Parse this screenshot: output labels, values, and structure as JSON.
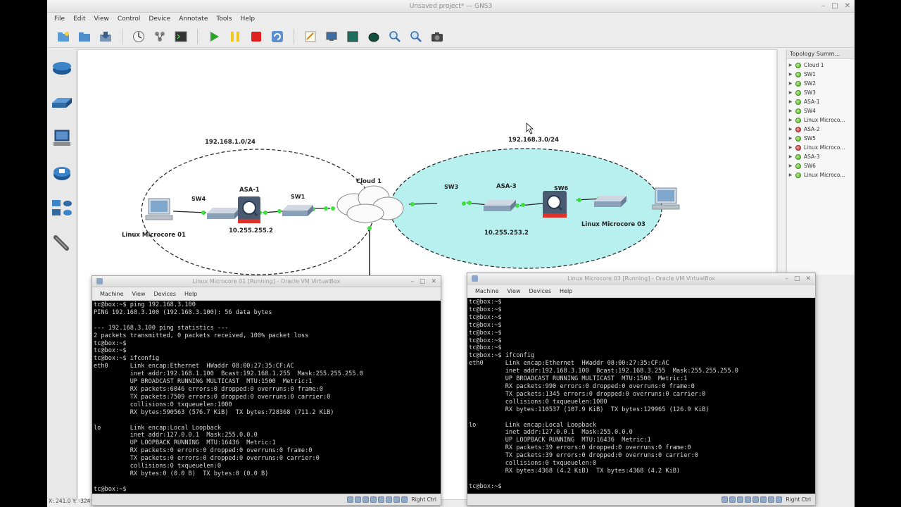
{
  "window": {
    "title": "Unsaved project* — GNS3",
    "status_coords": "X: 241.0 Y: -324"
  },
  "menu": [
    "File",
    "Edit",
    "View",
    "Control",
    "Device",
    "Annotate",
    "Tools",
    "Help"
  ],
  "toolbar": {
    "icons": [
      "new-project-icon",
      "open-project-icon",
      "save-project-icon",
      "snapshot-icon",
      "console-connect-icon",
      "terminal-icon",
      "start-icon",
      "suspend-icon",
      "stop-icon",
      "reload-icon",
      "note-icon",
      "screenshot-icon",
      "rectangle-icon",
      "ellipse-icon",
      "zoom-in-icon",
      "zoom-out-icon",
      "camera-icon"
    ]
  },
  "device_panel": [
    "router-icon",
    "switch-icon",
    "end-device-icon",
    "security-device-icon",
    "all-devices-icon",
    "cable-icon"
  ],
  "topology": {
    "header": "Topology Summ...",
    "items": [
      {
        "name": "Cloud 1",
        "status": "green"
      },
      {
        "name": "SW1",
        "status": "green"
      },
      {
        "name": "SW2",
        "status": "green"
      },
      {
        "name": "SW3",
        "status": "green"
      },
      {
        "name": "ASA-1",
        "status": "green"
      },
      {
        "name": "SW4",
        "status": "green"
      },
      {
        "name": "Linux Microco...",
        "status": "green"
      },
      {
        "name": "ASA-2",
        "status": "red"
      },
      {
        "name": "SW5",
        "status": "green"
      },
      {
        "name": "Linux Microco...",
        "status": "red"
      },
      {
        "name": "ASA-3",
        "status": "green"
      },
      {
        "name": "SW6",
        "status": "green"
      },
      {
        "name": "Linux Microco...",
        "status": "green"
      }
    ]
  },
  "diagram": {
    "left_network": "192.168.1.0/24",
    "right_network": "192.168.3.0/24",
    "cloud": "Cloud 1",
    "sw4": "SW4",
    "asa1": "ASA-1",
    "sw1": "SW1",
    "sw3": "SW3",
    "asa3": "ASA-3",
    "sw6": "SW6",
    "linux01": "Linux Microcore 01",
    "linux03": "Linux Microcore 03",
    "asa1_ip": "10.255.255.2",
    "asa3_ip": "10.255.253.2",
    "left_color": "#ffffff",
    "right_color": "#b8f0f0",
    "link_dot_color": "#3ee03e"
  },
  "vbox_left": {
    "title": "Linux Microcore 01 [Running] - Oracle VM VirtualBox",
    "menu": [
      "Machine",
      "View",
      "Devices",
      "Help"
    ],
    "hotkey": "Right Ctrl",
    "terminal": "tc@box:~$ ping 192.168.3.100\nPING 192.168.3.100 (192.168.3.100): 56 data bytes\n\n--- 192.168.3.100 ping statistics ---\n2 packets transmitted, 0 packets received, 100% packet loss\ntc@box:~$\ntc@box:~$\ntc@box:~$ ifconfig\neth0      Link encap:Ethernet  HWaddr 08:00:27:35:CF:AC\n          inet addr:192.168.1.100  Bcast:192.168.1.255  Mask:255.255.255.0\n          UP BROADCAST RUNNING MULTICAST  MTU:1500  Metric:1\n          RX packets:6046 errors:0 dropped:0 overruns:0 frame:0\n          TX packets:7509 errors:0 dropped:0 overruns:0 carrier:0\n          collisions:0 txqueuelen:1000\n          RX bytes:590563 (576.7 KiB)  TX bytes:728368 (711.2 KiB)\n\nlo        Link encap:Local Loopback\n          inet addr:127.0.0.1  Mask:255.0.0.0\n          UP LOOPBACK RUNNING  MTU:16436  Metric:1\n          RX packets:0 errors:0 dropped:0 overruns:0 frame:0\n          TX packets:0 errors:0 dropped:0 overruns:0 carrier:0\n          collisions:0 txqueuelen:0\n          RX bytes:0 (0.0 B)  TX bytes:0 (0.0 B)\n\ntc@box:~$"
  },
  "vbox_right": {
    "title": "Linux Microcore 03 [Running] - Oracle VM VirtualBox",
    "menu": [
      "Machine",
      "View",
      "Devices",
      "Help"
    ],
    "hotkey": "Right Ctrl",
    "terminal": "tc@box:~$\ntc@box:~$\ntc@box:~$\ntc@box:~$\ntc@box:~$\ntc@box:~$\ntc@box:~$\ntc@box:~$ ifconfig\neth0      Link encap:Ethernet  HWaddr 08:00:27:35:CF:AC\n          inet addr:192.168.3.100  Bcast:192.168.3.255  Mask:255.255.255.0\n          UP BROADCAST RUNNING MULTICAST  MTU:1500  Metric:1\n          RX packets:990 errors:0 dropped:0 overruns:0 frame:0\n          TX packets:1345 errors:0 dropped:0 overruns:0 carrier:0\n          collisions:0 txqueuelen:1000\n          RX bytes:110537 (107.9 KiB)  TX bytes:129965 (126.9 KiB)\n\nlo        Link encap:Local Loopback\n          inet addr:127.0.0.1  Mask:255.0.0.0\n          UP LOOPBACK RUNNING  MTU:16436  Metric:1\n          RX packets:39 errors:0 dropped:0 overruns:0 frame:0\n          TX packets:39 errors:0 dropped:0 overruns:0 carrier:0\n          collisions:0 txqueuelen:0\n          RX bytes:4368 (4.2 KiB)  TX bytes:4368 (4.2 KiB)\n\ntc@box:~$"
  }
}
